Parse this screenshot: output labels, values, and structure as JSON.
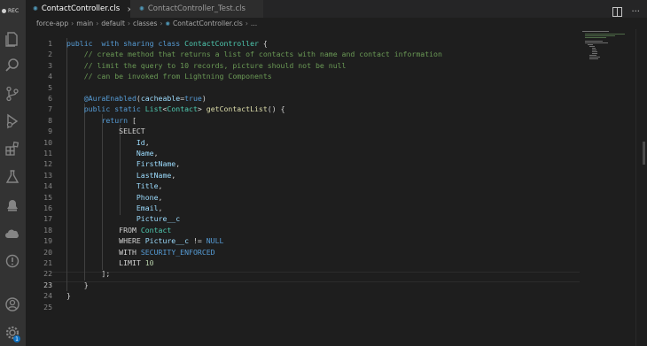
{
  "recording": {
    "label": "REC"
  },
  "tabs": [
    {
      "label": "ContactController.cls",
      "icon": "salesforce-apex-icon",
      "active": true
    },
    {
      "label": "ContactController_Test.cls",
      "icon": "salesforce-apex-icon",
      "active": false
    }
  ],
  "breadcrumb": [
    "force-app",
    "main",
    "default",
    "classes",
    "ContactController.cls",
    "..."
  ],
  "activity_bar": [
    "explorer-icon",
    "search-icon",
    "source-control-icon",
    "run-debug-icon",
    "extensions-icon",
    "testing-icon",
    "org-browser-icon",
    "salesforce-cloud-icon",
    "problems-icon",
    "accounts-icon",
    "settings-icon"
  ],
  "settings_badge": "1",
  "line_numbers": [
    "1",
    "2",
    "3",
    "4",
    "5",
    "6",
    "7",
    "8",
    "9",
    "10",
    "11",
    "12",
    "13",
    "14",
    "15",
    "16",
    "17",
    "18",
    "19",
    "20",
    "21",
    "22",
    "23",
    "24",
    "25"
  ],
  "current_line": "23",
  "code_lines": [
    [
      [
        "kw",
        "public"
      ],
      [
        "",
        "  "
      ],
      [
        "kw",
        "with"
      ],
      [
        "",
        " "
      ],
      [
        "kw",
        "sharing"
      ],
      [
        "",
        " "
      ],
      [
        "kw",
        "class"
      ],
      [
        "",
        " "
      ],
      [
        "cls",
        "ContactController"
      ],
      [
        "",
        " {"
      ]
    ],
    [
      [
        "",
        "    "
      ],
      [
        "cm",
        "// create method that returns a list of contacts with name and contact information"
      ]
    ],
    [
      [
        "",
        "    "
      ],
      [
        "cm",
        "// limit the query to 10 records, picture should not be null"
      ]
    ],
    [
      [
        "",
        "    "
      ],
      [
        "cm",
        "// can be invoked from Lightning Components"
      ]
    ],
    [],
    [
      [
        "",
        "    "
      ],
      [
        "kw",
        "@AuraEnabled"
      ],
      [
        "",
        "("
      ],
      [
        "fld",
        "cacheable"
      ],
      [
        "",
        "="
      ],
      [
        "kw",
        "true"
      ],
      [
        "",
        ")"
      ]
    ],
    [
      [
        "",
        "    "
      ],
      [
        "kw",
        "public"
      ],
      [
        "",
        " "
      ],
      [
        "kw",
        "static"
      ],
      [
        "",
        " "
      ],
      [
        "cls",
        "List"
      ],
      [
        "",
        "<"
      ],
      [
        "cls",
        "Contact"
      ],
      [
        "",
        "> "
      ],
      [
        "fn",
        "getContactList"
      ],
      [
        "",
        "() {"
      ]
    ],
    [
      [
        "",
        "        "
      ],
      [
        "kw",
        "return"
      ],
      [
        "",
        " ["
      ]
    ],
    [
      [
        "",
        "            SELECT"
      ]
    ],
    [
      [
        "",
        "                "
      ],
      [
        "fld",
        "Id"
      ],
      [
        "",
        ","
      ]
    ],
    [
      [
        "",
        "                "
      ],
      [
        "fld",
        "Name"
      ],
      [
        "",
        ","
      ]
    ],
    [
      [
        "",
        "                "
      ],
      [
        "fld",
        "FirstName"
      ],
      [
        "",
        ","
      ]
    ],
    [
      [
        "",
        "                "
      ],
      [
        "fld",
        "LastName"
      ],
      [
        "",
        ","
      ]
    ],
    [
      [
        "",
        "                "
      ],
      [
        "fld",
        "Title"
      ],
      [
        "",
        ","
      ]
    ],
    [
      [
        "",
        "                "
      ],
      [
        "fld",
        "Phone"
      ],
      [
        "",
        ","
      ]
    ],
    [
      [
        "",
        "                "
      ],
      [
        "fld",
        "Email"
      ],
      [
        "",
        ","
      ]
    ],
    [
      [
        "",
        "                "
      ],
      [
        "fld",
        "Picture__c"
      ]
    ],
    [
      [
        "",
        "            FROM "
      ],
      [
        "cls",
        "Contact"
      ]
    ],
    [
      [
        "",
        "            WHERE "
      ],
      [
        "fld",
        "Picture__c"
      ],
      [
        "",
        " != "
      ],
      [
        "kw",
        "NULL"
      ]
    ],
    [
      [
        "",
        "            WITH "
      ],
      [
        "kw",
        "SECURITY_ENFORCED"
      ]
    ],
    [
      [
        "",
        "            LIMIT "
      ],
      [
        "num",
        "10"
      ]
    ],
    [
      [
        "",
        "        ];"
      ]
    ],
    [
      [
        "",
        "    }"
      ]
    ],
    [
      [
        "",
        "}"
      ]
    ],
    []
  ]
}
